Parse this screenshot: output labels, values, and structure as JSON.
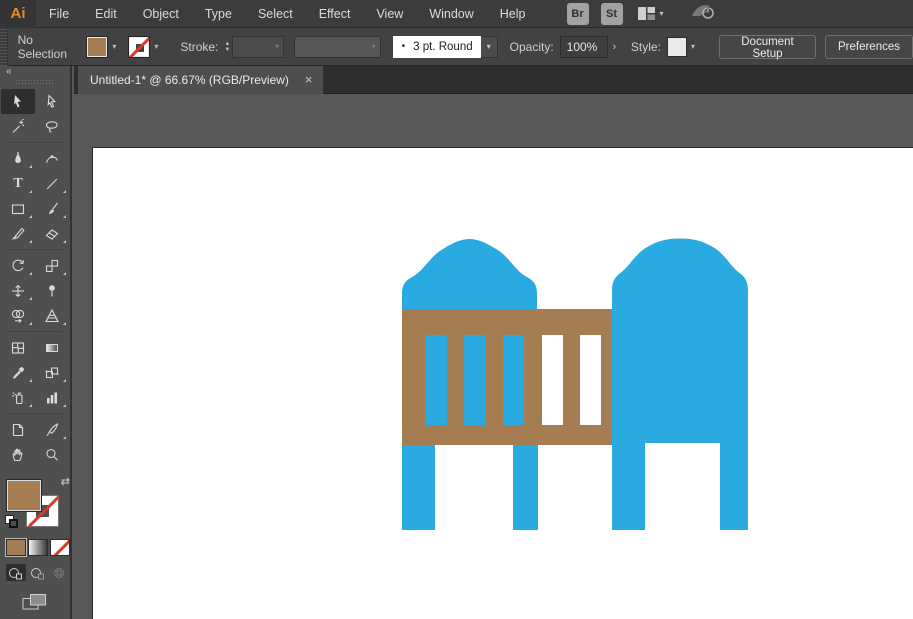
{
  "app": {
    "logo": "Ai"
  },
  "menubar": {
    "items": [
      "File",
      "Edit",
      "Object",
      "Type",
      "Select",
      "Effect",
      "View",
      "Window",
      "Help"
    ],
    "bridge_button": "Br",
    "stock_button": "St"
  },
  "controlbar": {
    "selection_status": "No Selection",
    "stroke_label": "Stroke:",
    "brush_dot": "•",
    "brush_name": "3 pt. Round",
    "opacity_label": "Opacity:",
    "opacity_value": "100%",
    "style_label": "Style:",
    "document_setup_button": "Document Setup",
    "preferences_button": "Preferences"
  },
  "tabbar": {
    "tab_title": "Untitled-1* @ 66.67% (RGB/Preview)"
  },
  "toolbar": {
    "collapse_glyph": "«",
    "type_tool_glyph": "T"
  },
  "icons": {
    "chevron_down": "▾",
    "chevron_right": "›",
    "close": "×",
    "swap": "⇄",
    "stepper_up": "▲",
    "stepper_down": "▼"
  },
  "colors": {
    "artwork_blue": "#29ABE2",
    "artwork_brown": "#A67C52",
    "fill_swatch_brown": "#A67C52",
    "none_slash_red": "#D63A32"
  }
}
